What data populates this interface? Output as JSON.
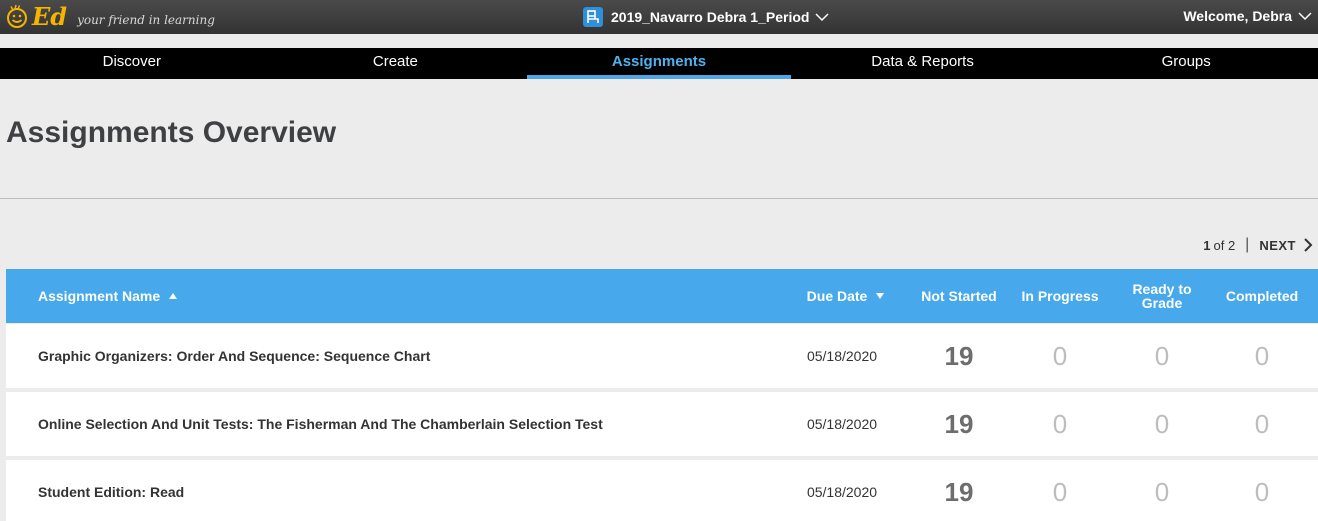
{
  "header": {
    "logo_text": "Ed",
    "tagline": "your friend in learning",
    "class_name": "2019_Navarro Debra 1_Period",
    "welcome": "Welcome, Debra"
  },
  "nav": {
    "items": [
      {
        "label": "Discover"
      },
      {
        "label": "Create"
      },
      {
        "label": "Assignments"
      },
      {
        "label": "Data & Reports"
      },
      {
        "label": "Groups"
      }
    ],
    "active": "Assignments"
  },
  "page": {
    "title": "Assignments Overview"
  },
  "pager": {
    "current": "1",
    "of": "of 2",
    "separator": "|",
    "next": "NEXT"
  },
  "table": {
    "headers": {
      "name": "Assignment Name",
      "due": "Due Date",
      "not_started": "Not Started",
      "in_progress": "In Progress",
      "ready_to_grade": "Ready to Grade",
      "completed": "Completed"
    },
    "rows": [
      {
        "name": "Graphic Organizers: Order And Sequence: Sequence Chart",
        "due": "05/18/2020",
        "not_started": "19",
        "in_progress": "0",
        "ready_to_grade": "0",
        "completed": "0"
      },
      {
        "name": "Online Selection And Unit Tests: The Fisherman And The Chamberlain Selection Test",
        "due": "05/18/2020",
        "not_started": "19",
        "in_progress": "0",
        "ready_to_grade": "0",
        "completed": "0"
      },
      {
        "name": "Student Edition: Read",
        "due": "05/18/2020",
        "not_started": "19",
        "in_progress": "0",
        "ready_to_grade": "0",
        "completed": "0"
      }
    ]
  },
  "colors": {
    "header_bar": "#47a8ec",
    "nav_active": "#4fb1f0",
    "logo": "#f5b400",
    "class_icon": "#2f8fd8"
  }
}
